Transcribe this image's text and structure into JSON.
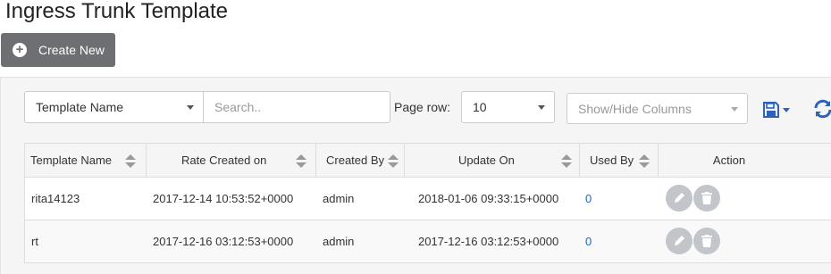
{
  "page": {
    "title": "Ingress Trunk Template"
  },
  "toolbar": {
    "create_label": "Create New"
  },
  "filters": {
    "field_select": "Template Name",
    "search_placeholder": "Search..",
    "page_row_label": "Page row:",
    "page_row_value": "10",
    "columns_placeholder": "Show/Hide Columns"
  },
  "table": {
    "columns": [
      "Template Name",
      "Rate Created on",
      "Created By",
      "Update On",
      "Used By",
      "Action"
    ],
    "rows": [
      {
        "name": "rita14123",
        "created_on": "2017-12-14 10:53:52+0000",
        "created_by": "admin",
        "updated_on": "2018-01-06 09:33:15+0000",
        "used_by": "0"
      },
      {
        "name": "rt",
        "created_on": "2017-12-16 03:12:53+0000",
        "created_by": "admin",
        "updated_on": "2017-12-16 03:12:53+0000",
        "used_by": "0"
      }
    ]
  },
  "icons": {
    "create": "plus-circle-icon",
    "save": "save-icon",
    "refresh": "refresh-icon",
    "edit": "pencil-icon",
    "delete": "trash-icon"
  },
  "colors": {
    "accent": "#2a63b8",
    "create_button": "#6d6f72",
    "action_button": "#c2c5ca"
  }
}
